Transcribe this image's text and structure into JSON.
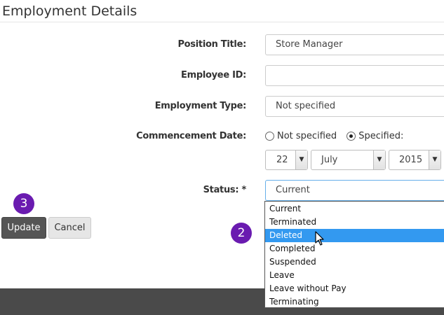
{
  "heading": "Employment Details",
  "fields": {
    "position_title": {
      "label": "Position Title:",
      "value": "Store Manager"
    },
    "employee_id": {
      "label": "Employee ID:",
      "value": ""
    },
    "employment_type": {
      "label": "Employment Type:",
      "value": "Not specified"
    },
    "commencement_date": {
      "label": "Commencement Date:",
      "options": [
        "Not specified",
        "Specified:"
      ],
      "selected": "Specified:",
      "day": "22",
      "month": "July",
      "year": "2015"
    },
    "status": {
      "label": "Status: *",
      "value": "Current",
      "options": [
        "Current",
        "Terminated",
        "Deleted",
        "Completed",
        "Suspended",
        "Leave",
        "Leave without Pay",
        "Terminating"
      ],
      "highlighted": "Deleted"
    }
  },
  "buttons": {
    "update": "Update",
    "cancel": "Cancel"
  },
  "badges": {
    "first": "3",
    "second": "2"
  },
  "colors": {
    "badge": "#6a1bb0",
    "highlight": "#3399f0",
    "primary_button": "#555555"
  },
  "icons": [
    "chevron-down-icon",
    "mouse-pointer-icon"
  ]
}
